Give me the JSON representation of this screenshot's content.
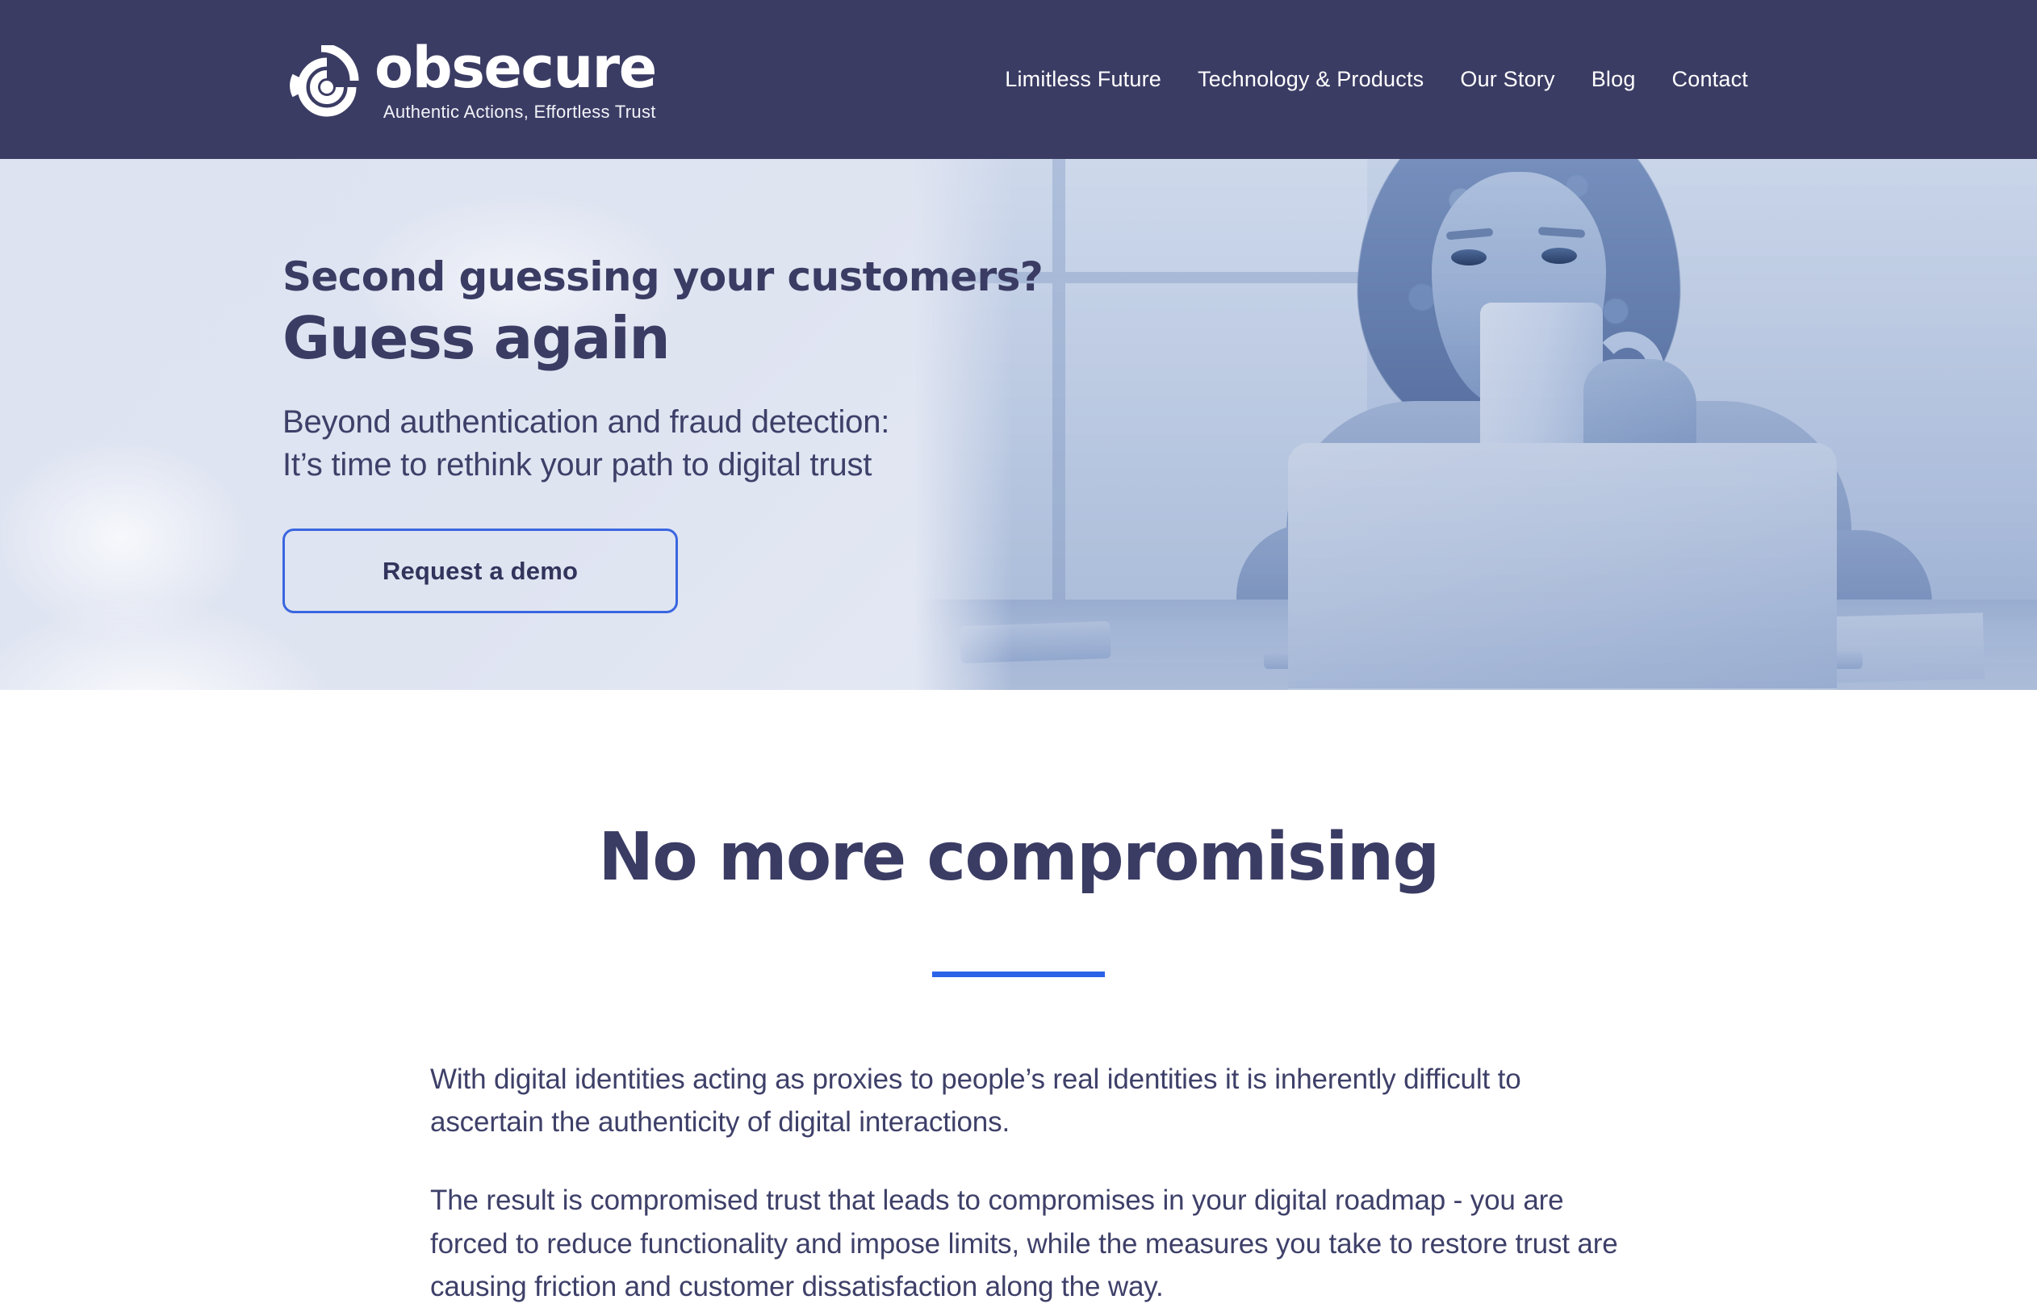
{
  "header": {
    "brand": {
      "icon": "obsecure-rings-logo-icon",
      "word": "obsecure",
      "tagline": "Authentic Actions, Effortless Trust"
    },
    "nav": [
      {
        "label": "Limitless Future"
      },
      {
        "label": "Technology & Products"
      },
      {
        "label": "Our Story"
      },
      {
        "label": "Blog"
      },
      {
        "label": "Contact"
      }
    ],
    "bg_color": "#3b3c64"
  },
  "hero": {
    "kicker": "Second guessing your customers?",
    "title": "Guess again",
    "subtitle_line1": "Beyond authentication and fraud detection:",
    "subtitle_line2": "It’s time to rethink your path to digital trust",
    "cta_label": "Request a demo",
    "cta_border_color": "#3a66e0",
    "image_alt": "woman-with-curly-hair-drinking-coffee-at-laptop"
  },
  "section": {
    "title": "No more compromising",
    "rule_color": "#2a62e8",
    "paragraphs": [
      "With digital identities acting as proxies to people’s real identities it is inherently difficult to ascertain the authenticity of digital interactions.",
      "The result is compromised trust that leads to compromises in your digital roadmap - you are forced to reduce functionality and impose limits, while the measures you take to restore trust are causing friction and customer dissatisfaction along the way."
    ]
  }
}
